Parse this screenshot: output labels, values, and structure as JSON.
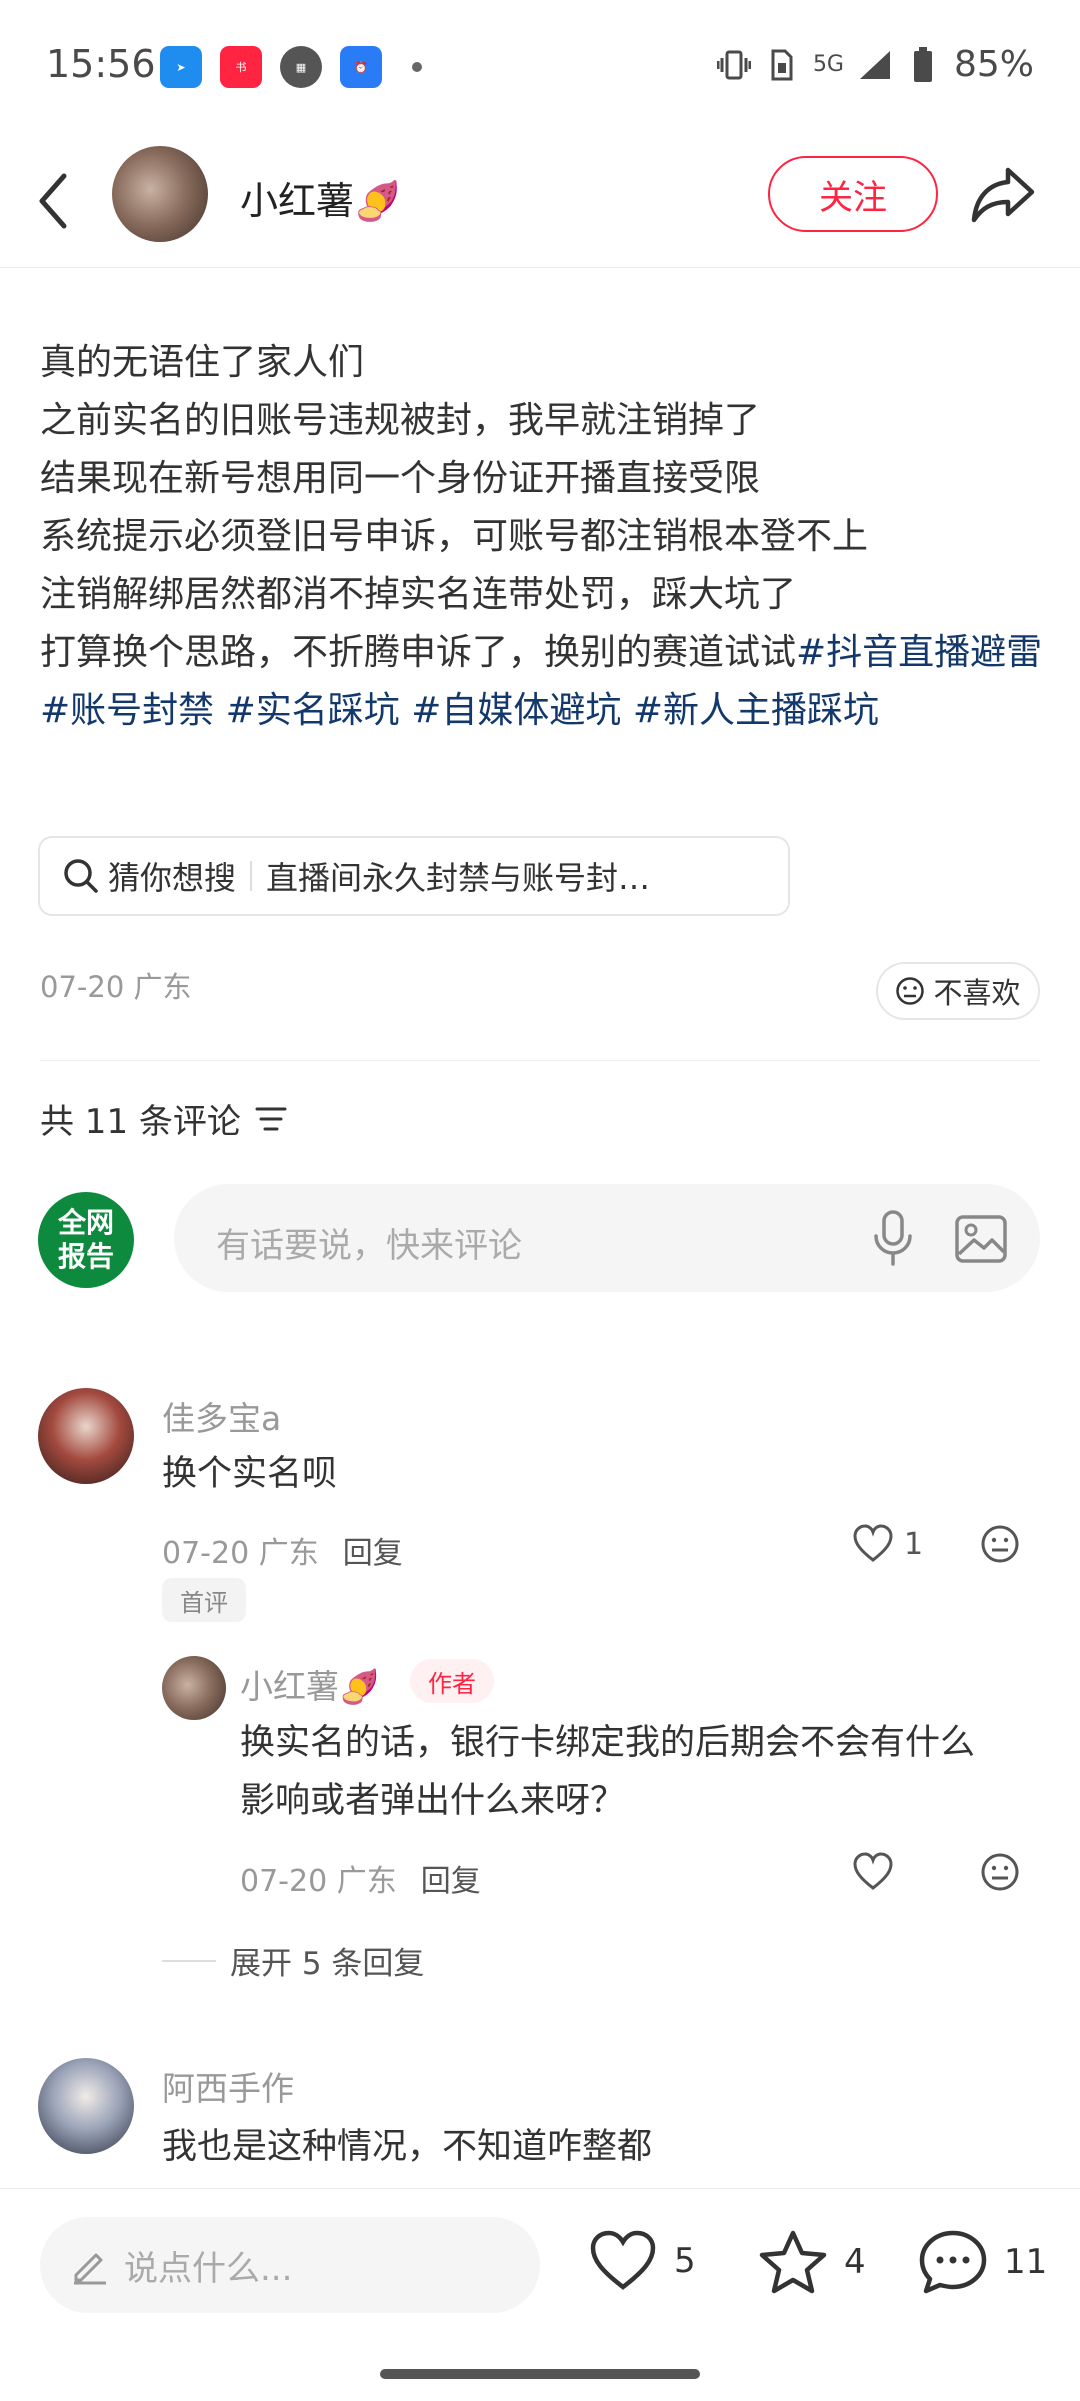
{
  "status_bar": {
    "time": "15:56",
    "network": "5G",
    "battery": "85%"
  },
  "header": {
    "author_name": "小红薯🍠",
    "follow_label": "关注"
  },
  "post": {
    "lines": [
      "真的无语住了家人们",
      "之前实名的旧账号违规被封，我早就注销掉了",
      "结果现在新号想用同一个身份证开播直接受限",
      "系统提示必须登旧号申诉，可账号都注销根本登不上",
      "注销解绑居然都消不掉实名连带处罚，踩大坑了"
    ],
    "last_line_prefix": "打算换个思路，不折腾申诉了，换别的赛道试试",
    "tags": [
      "#抖音直播避雷",
      "#账号封禁",
      "#实名踩坑",
      "#自媒体避坑",
      "#新人主播踩坑"
    ],
    "guess_label": "猜你想搜",
    "guess_query": "直播间永久封禁与账号封…",
    "meta": "07-20 广东",
    "dislike_label": "不喜欢"
  },
  "comments_header": {
    "count_label": "共 11 条评论"
  },
  "comment_box": {
    "report_line1": "全网",
    "report_line2": "报告",
    "placeholder": "有话要说，快来评论"
  },
  "comments": [
    {
      "name": "佳多宝a",
      "text": "换个实名呗",
      "meta": "07-20 广东",
      "reply_label": "回复",
      "likes": "1",
      "badge": "首评"
    },
    {
      "name": "小红薯🍠",
      "badge": "作者",
      "text_line1": "换实名的话，银行卡绑定我的后期会不会有什么",
      "text_line2": "影响或者弹出什么来呀？",
      "meta": "07-20 广东",
      "reply_label": "回复"
    },
    {
      "name": "阿西手作",
      "text": "我也是这种情况，不知道咋整都"
    }
  ],
  "expand_label": "展开 5 条回复",
  "bottom_bar": {
    "placeholder": "说点什么...",
    "likes": "5",
    "stars": "4",
    "comments": "11"
  },
  "colors": {
    "brand_red": "#ff2442",
    "tag_blue": "#13386c",
    "report_green": "#0e8a3f"
  }
}
